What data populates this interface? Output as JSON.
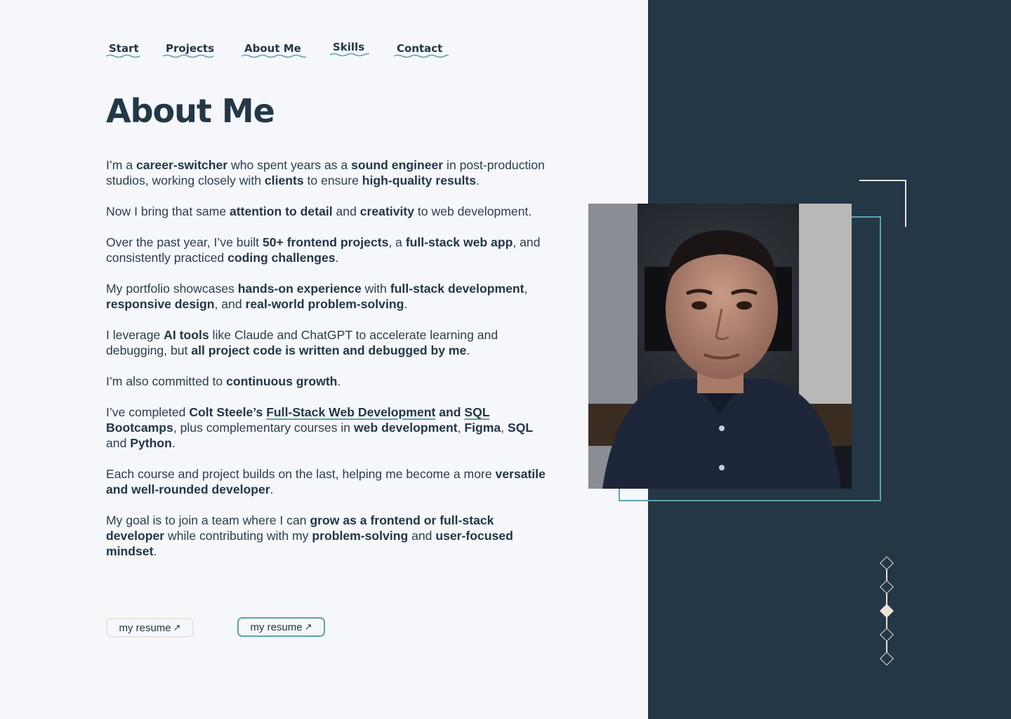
{
  "nav": [
    {
      "label": "Start"
    },
    {
      "label": "Projects"
    },
    {
      "label": "About Me"
    },
    {
      "label": "Skills"
    },
    {
      "label": "Contact"
    }
  ],
  "page_title": "About Me",
  "bio": {
    "p1": [
      "I’m a ",
      "career-switcher",
      " who spent years as a ",
      "sound engineer",
      " in post-production studios, working closely with ",
      "clients",
      " to ensure ",
      "high-quality results",
      "."
    ],
    "p2": [
      "Now I bring that same ",
      "attention to detail",
      " and ",
      "creativity",
      " to web development."
    ],
    "p3": [
      "Over the past year, I’ve built ",
      "50+ frontend projects",
      ", a ",
      "full-stack web app",
      ", and consistently practiced ",
      "coding challenges",
      "."
    ],
    "p4": [
      "My portfolio showcases ",
      "hands-on experience",
      " with ",
      "full-stack development",
      ", ",
      "responsive design",
      ", and ",
      "real-world problem-solving",
      "."
    ],
    "p5": [
      "I leverage ",
      "AI tools",
      " like Claude and ChatGPT to accelerate learning and debugging, but ",
      "all project code is written and debugged by me",
      "."
    ],
    "p6": [
      "I’m also committed to ",
      "continuous growth",
      "."
    ],
    "p7": [
      "I’ve completed ",
      "Colt Steele’s ",
      "Full-Stack Web Development",
      " and ",
      "SQL",
      " Bootcamps",
      ", plus complementary courses in ",
      "web development",
      ", ",
      "Figma",
      ", ",
      "SQL",
      " and ",
      "Python",
      "."
    ],
    "p8": [
      "Each course and project builds on the last, helping me become a more ",
      "versatile and well-rounded developer",
      "."
    ],
    "p9": [
      "My goal is to join a team where I can ",
      "grow as a frontend or full-stack developer",
      " while contributing with my ",
      "problem-solving",
      " and ",
      "user-focused mindset",
      "."
    ]
  },
  "buttons": [
    {
      "label": "my resume",
      "icon": "external-arrow-icon",
      "arrow": "↗"
    },
    {
      "label": "my resume",
      "icon": "external-arrow-icon",
      "arrow": "↗"
    }
  ],
  "pager": {
    "count": 5,
    "active_index": 2
  },
  "colors": {
    "background": "#f5f7fb",
    "panel": "#233746",
    "accent_teal": "#5fa3ad",
    "accent_cream": "#ece3d9",
    "text": "#233746"
  },
  "photo": {
    "icon": "profile-photo"
  }
}
